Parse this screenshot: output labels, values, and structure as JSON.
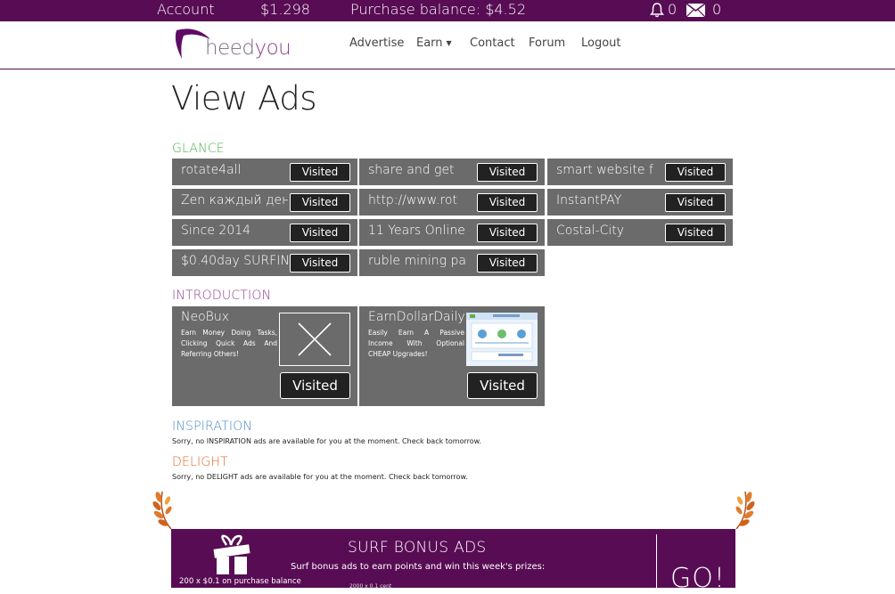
{
  "topbar": {
    "account_label": "Account",
    "account_balance": "$1.298",
    "purchase_balance": "Purchase balance: $4.52",
    "notifications_count": "0",
    "messages_count": "0",
    "bg_color": "#580c54"
  },
  "header": {
    "logo_text_a": "heed",
    "logo_text_b": "you",
    "nav": {
      "advertise": "Advertise",
      "earn": "Earn",
      "contact": "Contact",
      "forum": "Forum",
      "logout": "Logout"
    }
  },
  "page_title": "View Ads",
  "sections": {
    "glance": {
      "title": "GLANCE",
      "color": "#4fae4f",
      "ads": [
        {
          "title": "rotate4all",
          "button": "Visited"
        },
        {
          "title": "share and get",
          "button": "Visited"
        },
        {
          "title": "smart website f",
          "button": "Visited"
        },
        {
          "title": "Zen каждый день",
          "button": "Visited"
        },
        {
          "title": "http://www.rot",
          "button": "Visited"
        },
        {
          "title": "InstantPAY",
          "button": "Visited"
        },
        {
          "title": "Since 2014",
          "button": "Visited"
        },
        {
          "title": "11 Years Online",
          "button": "Visited"
        },
        {
          "title": "Costal-City",
          "button": "Visited"
        },
        {
          "title": "$0.40day SURFIN",
          "button": "Visited"
        },
        {
          "title": "ruble mining pa",
          "button": "Visited"
        }
      ]
    },
    "introduction": {
      "title": "INTRODUCTION",
      "color": "#8e3e8e",
      "ads": [
        {
          "title": "NeoBux",
          "desc": "Earn Money Doing Tasks, Clicking Quick Ads And Referring Others!",
          "button": "Visited",
          "thumb": "placeholder-x-icon"
        },
        {
          "title": "EarnDollarDaily",
          "desc": "Easily Earn A Passive Income With Optional CHEAP Upgrades!",
          "button": "Visited",
          "thumb": "website-screenshot"
        }
      ]
    },
    "inspiration": {
      "title": "INSPIRATION",
      "color": "#4b8bc6",
      "notice": "Sorry, no INSPIRATION ads are available for you at the moment. Check back tomorrow."
    },
    "delight": {
      "title": "DELIGHT",
      "color": "#e06a2c",
      "notice": "Sorry, no DELIGHT ads are available for you at the moment. Check back tomorrow."
    }
  },
  "surf_bonus": {
    "title": "SURF BONUS ADS",
    "subtitle": "Surf bonus ads to earn points and win this week's prizes:",
    "prize_note": "200 x $0.1 on purchase balance",
    "prize_line_2": "2000 x 0.1 cent",
    "go_label": "GO!",
    "icon": "gift-icon"
  }
}
